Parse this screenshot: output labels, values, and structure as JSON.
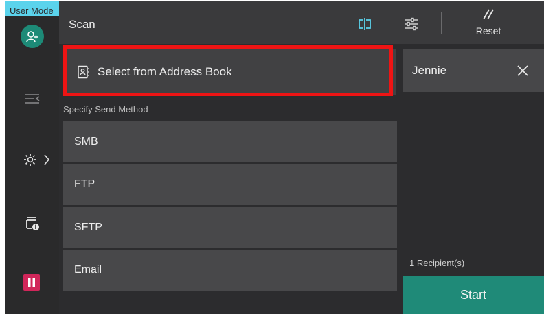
{
  "mode_strip": {
    "label": "User Mode"
  },
  "header": {
    "title": "Scan",
    "reset_label": "Reset"
  },
  "address_book": {
    "label": "Select from Address Book"
  },
  "send_method": {
    "section_label": "Specify Send Method",
    "options": [
      "SMB",
      "FTP",
      "SFTP",
      "Email"
    ]
  },
  "recipients": {
    "items": [
      {
        "name": "Jennie"
      }
    ],
    "count_label": "1 Recipient(s)"
  },
  "start": {
    "label": "Start"
  },
  "icons": {
    "user": "user-icon",
    "job_status": "job-status-icon",
    "settings": "gear-icon",
    "device_info": "printer-info-icon",
    "pause": "pause-icon",
    "preview": "preview-icon",
    "adjust": "sliders-icon",
    "reset": "reset-icon",
    "address_book": "address-book-icon",
    "remove": "close-icon"
  },
  "colors": {
    "accent": "#1f8a78",
    "highlight": "#ee1414",
    "mode_strip": "#5bd3ec",
    "pause": "#d1265a"
  }
}
